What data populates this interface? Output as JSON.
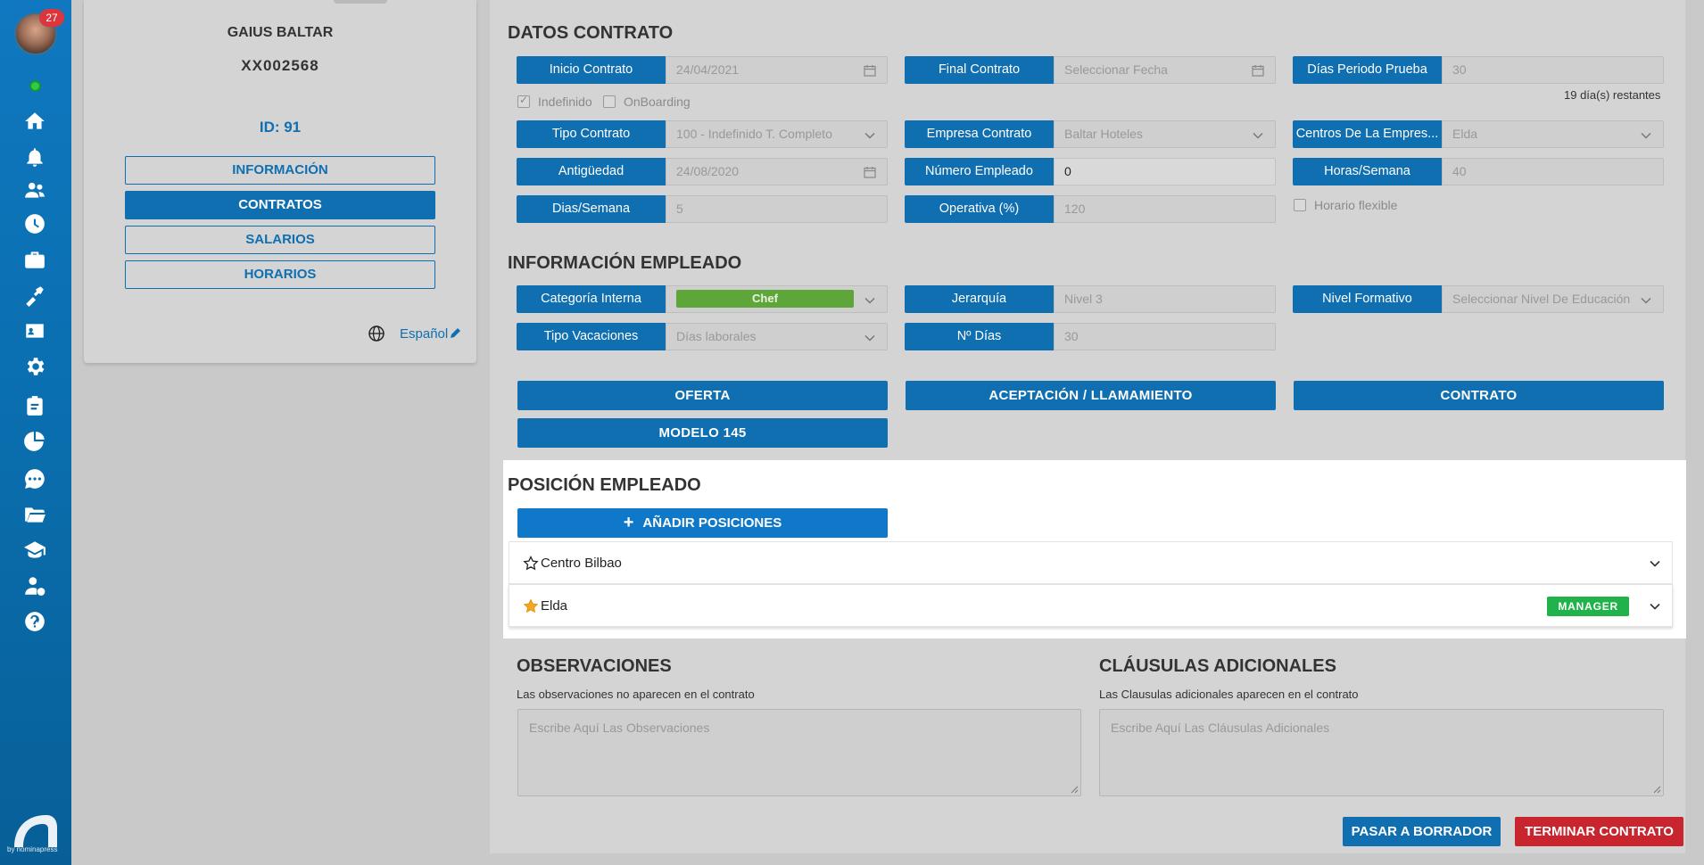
{
  "sidebar": {
    "notification_count": "27",
    "icons": [
      "home-icon",
      "bell-icon",
      "users-icon",
      "clock-icon",
      "briefcase-icon",
      "tools-icon",
      "id-card-icon",
      "gear-icon",
      "clipboard-icon",
      "pie-chart-icon",
      "chat-icon",
      "folder-icon",
      "graduation-icon",
      "user-money-icon",
      "help-icon"
    ],
    "logo_caption": "by nominapress",
    "accent_color": "#0f78c0"
  },
  "employee": {
    "name": "GAIUS BALTAR",
    "code": "XX002568",
    "id_label": "ID: 91",
    "menu": [
      "INFORMACIÓN",
      "CONTRATOS",
      "SALARIOS",
      "HORARIOS"
    ],
    "active_menu": "CONTRATOS",
    "language": "Español"
  },
  "contract": {
    "title": "DATOS CONTRATO",
    "inicio_label": "Inicio Contrato",
    "inicio_value": "24/04/2021",
    "final_label": "Final Contrato",
    "final_placeholder": "Seleccionar Fecha",
    "prueba_label": "Días Periodo Prueba",
    "prueba_value": "30",
    "remaining": "19 día(s) restantes",
    "indefinido": "Indefinido",
    "onboarding": "OnBoarding",
    "tipo_label": "Tipo Contrato",
    "tipo_value": "100 - Indefinido T. Completo",
    "empresa_label": "Empresa Contrato",
    "empresa_value": "Baltar Hoteles",
    "centros_label": "Centros De La Empres...",
    "centros_value": "Elda",
    "antiguedad_label": "Antigüedad",
    "antiguedad_value": "24/08/2020",
    "numero_label": "Número Empleado",
    "numero_value": "0",
    "horas_label": "Horas/Semana",
    "horas_value": "40",
    "dias_label": "Dias/Semana",
    "dias_value": "5",
    "operativa_label": "Operativa (%)",
    "operativa_value": "120",
    "flexible": "Horario flexible"
  },
  "employee_info": {
    "title": "INFORMACIÓN EMPLEADO",
    "categoria_label": "Categoría Interna",
    "categoria_value": "Chef",
    "jerarquia_label": "Jerarquía",
    "jerarquia_value": "Nivel 3",
    "nivel_label": "Nivel Formativo",
    "nivel_placeholder": "Seleccionar Nivel De Educación",
    "vacaciones_label": "Tipo Vacaciones",
    "vacaciones_value": "Días laborales",
    "ndias_label": "Nº Días",
    "ndias_value": "30"
  },
  "documents": [
    "OFERTA",
    "ACEPTACIÓN / LLAMAMIENTO",
    "CONTRATO",
    "MODELO 145"
  ],
  "positions": {
    "title": "POSICIÓN EMPLEADO",
    "add_label": "AÑADIR POSICIONES",
    "items": [
      {
        "name": "Centro Bilbao",
        "starred": false,
        "badge": ""
      },
      {
        "name": "Elda",
        "starred": true,
        "badge": "MANAGER"
      }
    ]
  },
  "observaciones": {
    "title": "OBSERVACIONES",
    "note": "Las observaciones no aparecen en el contrato",
    "placeholder": "Escribe Aquí Las Observaciones"
  },
  "clausulas": {
    "title": "CLÁUSULAS ADICIONALES",
    "note": "Las Clausulas adicionales aparecen en el contrato",
    "placeholder": "Escribe Aquí Las Cláusulas Adicionales"
  },
  "actions": {
    "draft": "PASAR A BORRADOR",
    "terminate": "TERMINAR CONTRATO"
  }
}
